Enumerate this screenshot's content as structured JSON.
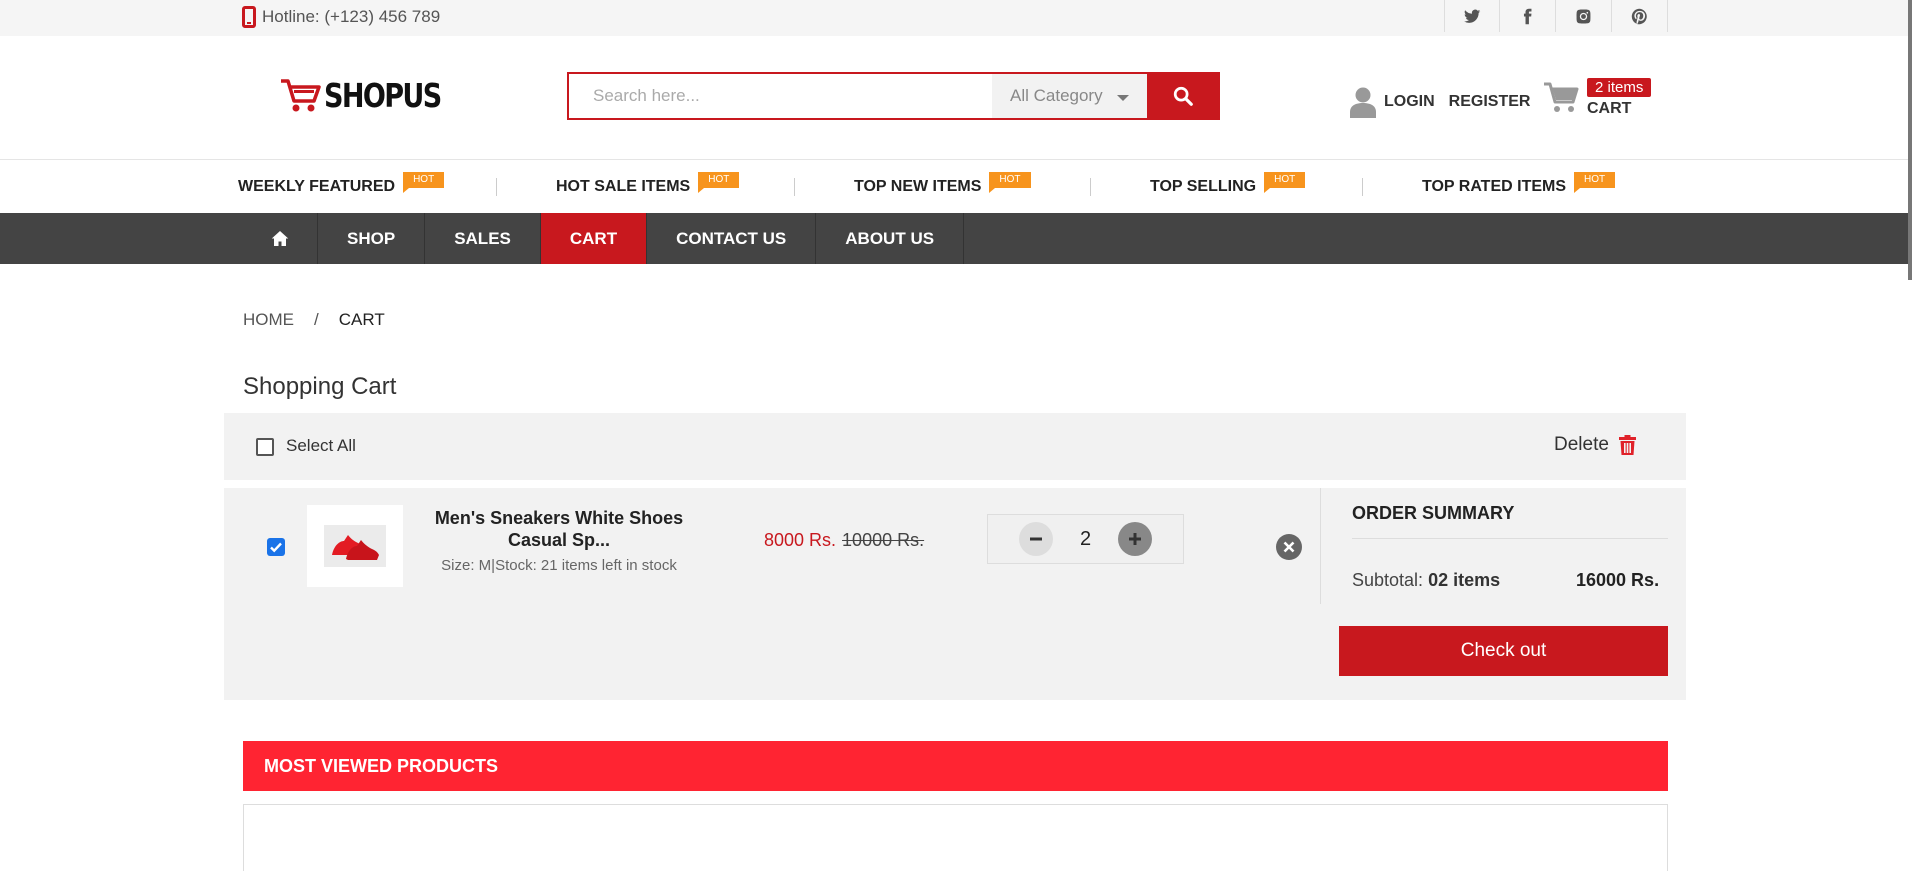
{
  "topbar": {
    "hotline": "Hotline: (+123) 456 789",
    "social": [
      "twitter-icon",
      "facebook-icon",
      "instagram-icon",
      "pinterest-icon"
    ]
  },
  "header": {
    "logo_text": "SHOPUS",
    "search_placeholder": "Search here...",
    "category": "All Category",
    "login": "LOGIN",
    "register": "REGISTER",
    "cart_count": "2 items",
    "cart_label": "CART"
  },
  "featured": [
    {
      "label": "WEEKLY FEATURED",
      "badge": "HOT"
    },
    {
      "label": "HOT SALE ITEMS",
      "badge": "HOT"
    },
    {
      "label": "TOP NEW ITEMS",
      "badge": "HOT"
    },
    {
      "label": "TOP SELLING",
      "badge": "HOT"
    },
    {
      "label": "TOP RATED ITEMS",
      "badge": "HOT"
    }
  ],
  "nav": [
    "SHOP",
    "SALES",
    "CART",
    "CONTACT US",
    "ABOUT US"
  ],
  "breadcrumb": {
    "home": "HOME",
    "sep": "/",
    "current": "CART"
  },
  "page_title": "Shopping Cart",
  "select_bar": {
    "select_all": "Select All",
    "delete": "Delete"
  },
  "item": {
    "name": "Men's Sneakers White Shoes Casual Sp...",
    "meta": "Size: M|Stock: 21 items left in stock",
    "price": "8000 Rs.",
    "old_price": "10000 Rs.",
    "qty": "2",
    "checked": true
  },
  "summary": {
    "title": "ORDER SUMMARY",
    "subtotal_label": "Subtotal:",
    "subtotal_items": "02 items",
    "subtotal_value": "16000 Rs.",
    "checkout": "Check out"
  },
  "most_viewed": "MOST VIEWED PRODUCTS",
  "colors": {
    "brand": "#c8181e",
    "hot": "#f7941d",
    "nav": "#444444",
    "section": "#ff2432"
  }
}
